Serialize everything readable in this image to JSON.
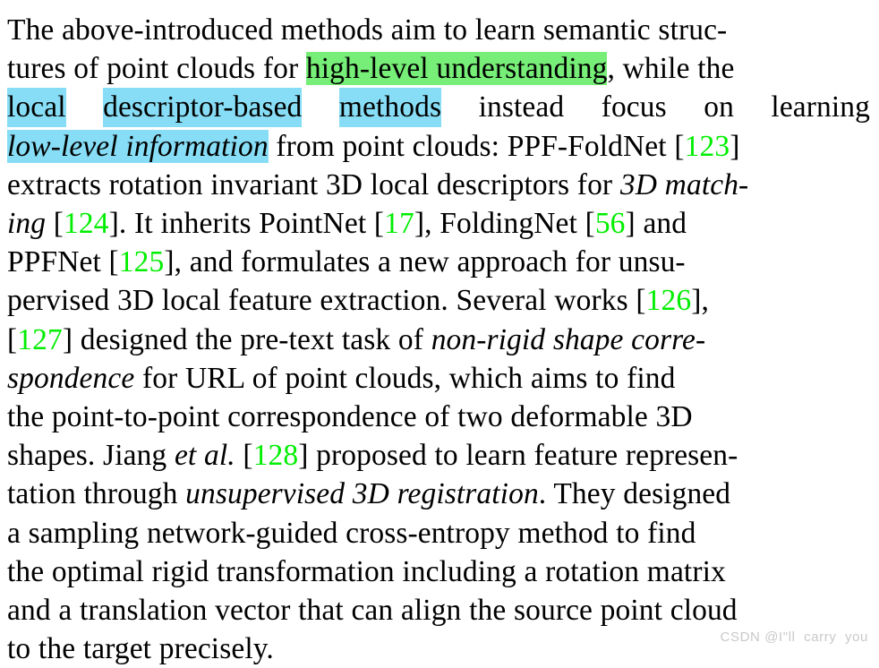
{
  "document": {
    "type": "academic-paper-paragraph",
    "background_color": "#ffffff",
    "text_color": "#000000",
    "citation_color": "#00ee00",
    "highlight_green": "#77ee77",
    "highlight_blue": "#87ddf5",
    "full_text": "The above-introduced methods aim to learn semantic structures of point clouds for high-level understanding, while the local descriptor-based methods instead focus on learning low-level information from point clouds: PPF-FoldNet [123] extracts rotation invariant 3D local descriptors for 3D matching [124]. It inherits PointNet [17], FoldingNet [56] and PPFNet [125], and formulates a new approach for unsupervised 3D local feature extraction. Several works [126], [127] designed the pre-text task of non-rigid shape correspondence for URL of point clouds, which aims to find the point-to-point correspondence of two deformable 3D shapes. Jiang et al. [128] proposed to learn feature representation through unsupervised 3D registration. They designed a sampling network-guided cross-entropy method to find the optimal rigid transformation including a rotation matrix and a translation vector that can align the source point cloud to the target precisely."
  },
  "lines": [
    {
      "id": "line-1",
      "words": [
        {
          "t": "The above-introduced methods aim to learn semantic struc-"
        }
      ]
    },
    {
      "id": "line-2",
      "words": [
        {
          "t": "tures of point clouds for "
        },
        {
          "t": "high-level understanding",
          "style": "hl-green"
        },
        {
          "t": ", while the"
        }
      ]
    },
    {
      "id": "line-3",
      "words": [
        {
          "t": "local",
          "style": "hl-blue"
        },
        {
          "t": "descriptor-based",
          "style": "hl-blue"
        },
        {
          "t": "methods",
          "style": "hl-blue"
        },
        {
          "t": "instead"
        },
        {
          "t": "focus"
        },
        {
          "t": "on"
        },
        {
          "t": "learning"
        }
      ],
      "justify": true
    },
    {
      "id": "line-4",
      "words": [
        {
          "t": "low-level information",
          "style": "hl-blue it"
        },
        {
          "t": " from point clouds: PPF-FoldNet ["
        },
        {
          "t": "123",
          "style": "cite"
        },
        {
          "t": "]"
        }
      ]
    },
    {
      "id": "line-5",
      "words": [
        {
          "t": "extracts rotation invariant 3D local descriptors for "
        },
        {
          "t": "3D match-",
          "style": "it"
        }
      ]
    },
    {
      "id": "line-6",
      "words": [
        {
          "t": "ing",
          "style": "it"
        },
        {
          "t": " ["
        },
        {
          "t": "124",
          "style": "cite"
        },
        {
          "t": "]. It inherits PointNet ["
        },
        {
          "t": "17",
          "style": "cite"
        },
        {
          "t": "], FoldingNet ["
        },
        {
          "t": "56",
          "style": "cite"
        },
        {
          "t": "] and"
        }
      ]
    },
    {
      "id": "line-7",
      "words": [
        {
          "t": "PPFNet ["
        },
        {
          "t": "125",
          "style": "cite"
        },
        {
          "t": "], and formulates a new approach for unsu-"
        }
      ]
    },
    {
      "id": "line-8",
      "words": [
        {
          "t": "pervised 3D local feature extraction. Several works ["
        },
        {
          "t": "126",
          "style": "cite"
        },
        {
          "t": "],"
        }
      ]
    },
    {
      "id": "line-9",
      "words": [
        {
          "t": "["
        },
        {
          "t": "127",
          "style": "cite"
        },
        {
          "t": "] designed the pre-text task of "
        },
        {
          "t": "non-rigid shape corre-",
          "style": "it"
        }
      ]
    },
    {
      "id": "line-10",
      "words": [
        {
          "t": "spondence",
          "style": "it"
        },
        {
          "t": " for URL of point clouds, which aims to find"
        }
      ]
    },
    {
      "id": "line-11",
      "words": [
        {
          "t": "the point-to-point correspondence of two deformable 3D"
        }
      ]
    },
    {
      "id": "line-12",
      "words": [
        {
          "t": "shapes. Jiang "
        },
        {
          "t": "et al.",
          "style": "it"
        },
        {
          "t": " ["
        },
        {
          "t": "128",
          "style": "cite"
        },
        {
          "t": "] proposed to learn feature represen-"
        }
      ]
    },
    {
      "id": "line-13",
      "words": [
        {
          "t": "tation through "
        },
        {
          "t": "unsupervised 3D registration",
          "style": "it"
        },
        {
          "t": ". They designed"
        }
      ]
    },
    {
      "id": "line-14",
      "words": [
        {
          "t": "a sampling network-guided cross-entropy method to find"
        }
      ]
    },
    {
      "id": "line-15",
      "words": [
        {
          "t": "the optimal rigid transformation including a rotation matrix"
        }
      ]
    },
    {
      "id": "line-16",
      "words": [
        {
          "t": "and a translation vector that can align the source point cloud"
        }
      ]
    },
    {
      "id": "line-17",
      "words": [
        {
          "t": "to the target precisely."
        }
      ]
    }
  ],
  "citations": [
    "123",
    "124",
    "17",
    "56",
    "125",
    "126",
    "127",
    "128"
  ],
  "highlights": {
    "green": [
      "high-level understanding"
    ],
    "blue": [
      "local descriptor-based methods",
      "low-level information"
    ]
  },
  "watermark": {
    "text": "CSDN @I\"ll  carry  you",
    "color": "#c9c9c9"
  }
}
